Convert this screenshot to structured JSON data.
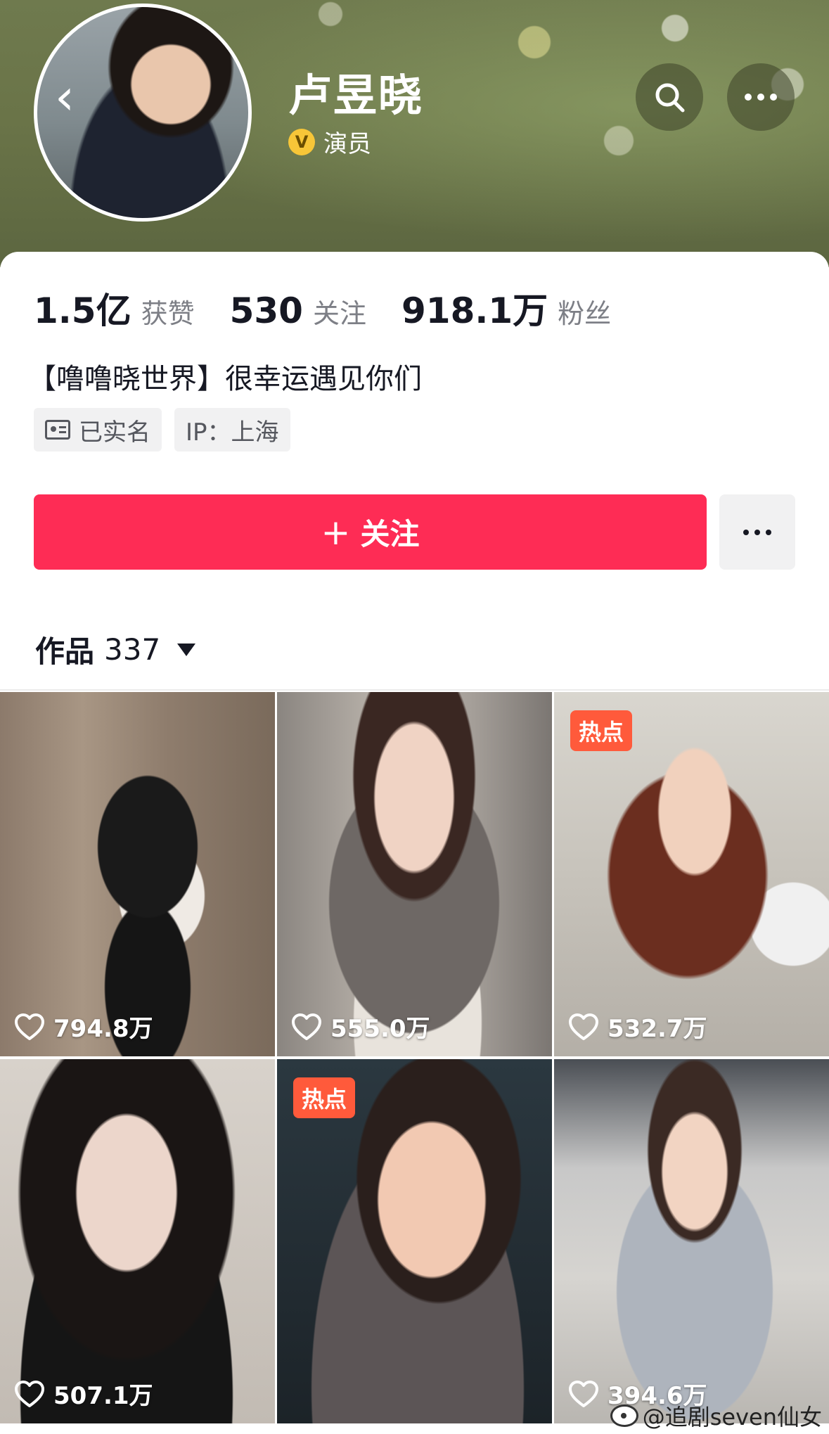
{
  "header": {
    "name": "卢昱晓",
    "verification_label": "演员",
    "verification_badge": "V"
  },
  "stats": [
    {
      "value": "1.5亿",
      "label": "获赞"
    },
    {
      "value": "530",
      "label": "关注"
    },
    {
      "value": "918.1万",
      "label": "粉丝"
    }
  ],
  "bio": "【噜噜晓世界】很幸运遇见你们",
  "tags": {
    "verified": "已实名",
    "ip": "IP：上海"
  },
  "actions": {
    "follow_label": "关注",
    "follow_plus": "+"
  },
  "works": {
    "label": "作品",
    "count": "337"
  },
  "videos": [
    {
      "likes": "794.8万",
      "hot": ""
    },
    {
      "likes": "555.0万",
      "hot": ""
    },
    {
      "likes": "532.7万",
      "hot": "热点"
    },
    {
      "likes": "507.1万",
      "hot": ""
    },
    {
      "likes": "",
      "hot": "热点"
    },
    {
      "likes": "394.6万",
      "hot": ""
    }
  ],
  "watermark": "@追剧seven仙女",
  "colors": {
    "follow_button": "#fe2c55",
    "hot_badge": "#ff5a3b",
    "verify_badge": "#f7c638"
  },
  "icons": [
    "back-icon",
    "search-icon",
    "more-icon",
    "id-card-icon",
    "dropdown-icon",
    "heart-icon",
    "weibo-icon"
  ]
}
